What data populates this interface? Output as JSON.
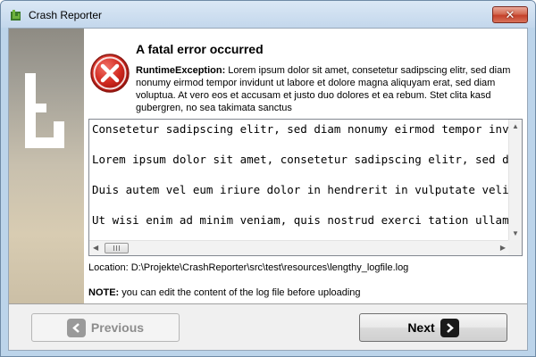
{
  "window": {
    "title": "Crash Reporter",
    "close_glyph": "✕"
  },
  "icons": {
    "app": "app-logo-icon",
    "sidebar": "brand-logo-icon",
    "error": "error-icon",
    "close": "close-icon",
    "prev": "arrow-left-icon",
    "next": "arrow-right-icon"
  },
  "main": {
    "heading": "A fatal error occurred",
    "exception_name": "RuntimeException:",
    "exception_message": " Lorem ipsum dolor sit amet, consetetur sadipscing elitr, sed diam nonumy eirmod tempor invidunt ut labore et dolore magna aliquyam erat, sed diam voluptua. At vero eos et accusam et justo duo dolores et ea rebum. Stet clita kasd gubergren, no sea takimata sanctus"
  },
  "log": {
    "lines": [
      "Consetetur sadipscing elitr, sed diam nonumy eirmod tempor invidunt ut labore",
      "",
      "Lorem ipsum dolor sit amet, consetetur sadipscing elitr, sed diam nonumy",
      "",
      "Duis autem vel eum iriure dolor in hendrerit in vulputate velit esse",
      "",
      "Ut wisi enim ad minim veniam, quis nostrud exerci tation ullamcorper"
    ]
  },
  "location": {
    "label": "Location:",
    "path": "D:\\Projekte\\CrashReporter\\src\\test\\resources\\lengthy_logfile.log"
  },
  "note": {
    "label": "NOTE:",
    "text": " you can edit the content of the log file before uploading"
  },
  "buttons": {
    "previous": "Previous",
    "next": "Next"
  },
  "colors": {
    "error_red": "#c8201a",
    "window_frame": "#bcd4ea",
    "close_red": "#c4402a"
  }
}
